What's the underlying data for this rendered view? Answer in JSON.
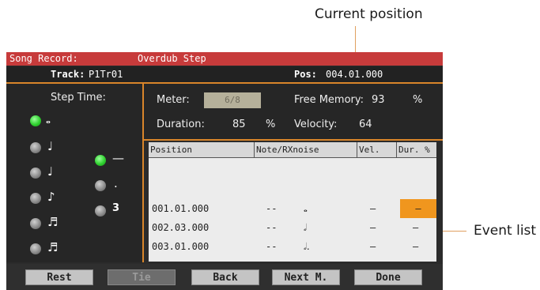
{
  "callouts": {
    "current_position": "Current position",
    "event_list": "Event list"
  },
  "titlebar": {
    "left": "Song Record:",
    "mode": "Overdub Step"
  },
  "trackbar": {
    "track_label": "Track:",
    "track_value": "P1Tr01",
    "pos_label": "Pos:",
    "pos_value": "004.01.000"
  },
  "step_time": {
    "title": "Step Time:",
    "notes": [
      {
        "icon": "whole-note-icon",
        "glyph": "𝅝",
        "selected": true
      },
      {
        "icon": "half-note-icon",
        "glyph": "♩",
        "selected": false
      },
      {
        "icon": "quarter-note-icon",
        "glyph": "♩",
        "selected": false
      },
      {
        "icon": "eighth-note-icon",
        "glyph": "♪",
        "selected": false
      },
      {
        "icon": "sixteenth-note-icon",
        "glyph": "♬",
        "selected": false
      },
      {
        "icon": "thirtysecond-note-icon",
        "glyph": "♬",
        "selected": false
      }
    ],
    "modifiers": [
      {
        "icon": "normal-icon",
        "glyph": "—",
        "selected": true
      },
      {
        "icon": "dot-icon",
        "glyph": ".",
        "selected": false
      },
      {
        "icon": "triplet-icon",
        "glyph": "3",
        "selected": false
      }
    ]
  },
  "info": {
    "meter_label": "Meter:",
    "meter_value": "6/8",
    "free_memory_label": "Free Memory:",
    "free_memory_value": "93",
    "free_memory_unit": "%",
    "duration_label": "Duration:",
    "duration_value": "85",
    "duration_unit": "%",
    "velocity_label": "Velocity:",
    "velocity_value": "64"
  },
  "event_table": {
    "headers": [
      "Position",
      "Note/RXnoise",
      "Vel.",
      "Dur. %"
    ],
    "rows": [
      {
        "position": "001.01.000",
        "note": "--",
        "note_glyph": "𝅝",
        "vel": "–",
        "dur": "–"
      },
      {
        "position": "002.03.000",
        "note": "--",
        "note_glyph": "𝅗𝅥",
        "vel": "–",
        "dur": "–"
      },
      {
        "position": "003.01.000",
        "note": "--",
        "note_glyph": "𝅗𝅥.",
        "vel": "–",
        "dur": "–"
      }
    ]
  },
  "buttons": {
    "rest": "Rest",
    "tie": "Tie",
    "back": "Back",
    "next": "Next M.",
    "done": "Done"
  }
}
